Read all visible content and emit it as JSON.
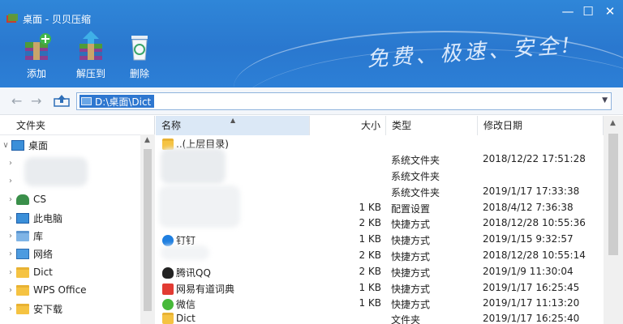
{
  "window": {
    "title": "桌面 - 贝贝压缩",
    "slogan": "免费、极速、安全!",
    "minimize": "—",
    "maximize": "☐",
    "close": "✕"
  },
  "toolbar": {
    "add_label": "添加",
    "extract_label": "解压到",
    "delete_label": "删除"
  },
  "address": {
    "path": "D:\\桌面\\Dict"
  },
  "left_panel": {
    "header": "文件夹",
    "items": [
      {
        "label": "桌面",
        "icon": "monitor-icon",
        "expanded": true
      },
      {
        "label": "",
        "icon": "blurred"
      },
      {
        "label": "",
        "icon": "blurred"
      },
      {
        "label": "CS",
        "icon": "user-icon"
      },
      {
        "label": "此电脑",
        "icon": "monitor-icon"
      },
      {
        "label": "库",
        "icon": "library-icon"
      },
      {
        "label": "网络",
        "icon": "network-icon"
      },
      {
        "label": "Dict",
        "icon": "folder-icon"
      },
      {
        "label": "WPS Office",
        "icon": "folder-icon"
      },
      {
        "label": "安下载",
        "icon": "folder-icon"
      }
    ]
  },
  "columns": {
    "name": "名称",
    "size": "大小",
    "type": "类型",
    "date": "修改日期"
  },
  "files": [
    {
      "name": "..(上层目录)",
      "size": "",
      "type": "",
      "date": "",
      "icon": "folder-icon"
    },
    {
      "name": "",
      "size": "",
      "type": "系统文件夹",
      "date": "2018/12/22 17:51:28",
      "icon": "blurred"
    },
    {
      "name": "",
      "size": "",
      "type": "系统文件夹",
      "date": "",
      "icon": "blurred"
    },
    {
      "name": "",
      "size": "",
      "type": "系统文件夹",
      "date": "2019/1/17 17:33:38",
      "icon": "blurred"
    },
    {
      "name": "",
      "size": "1 KB",
      "type": "配置设置",
      "date": "2018/4/12 7:36:38",
      "icon": "blurred"
    },
    {
      "name": "",
      "size": "2 KB",
      "type": "快捷方式",
      "date": "2018/12/28 10:55:36",
      "icon": "blurred"
    },
    {
      "name": "钉钉",
      "size": "1 KB",
      "type": "快捷方式",
      "date": "2019/1/15 9:32:57",
      "icon": "dingtalk-icon"
    },
    {
      "name": "",
      "size": "2 KB",
      "type": "快捷方式",
      "date": "2018/12/28 10:55:14",
      "icon": "blurred"
    },
    {
      "name": "腾讯QQ",
      "size": "2 KB",
      "type": "快捷方式",
      "date": "2019/1/9 11:30:04",
      "icon": "qq-icon"
    },
    {
      "name": "网易有道词典",
      "size": "1 KB",
      "type": "快捷方式",
      "date": "2019/1/17 16:25:45",
      "icon": "youdao-icon"
    },
    {
      "name": "微信",
      "size": "1 KB",
      "type": "快捷方式",
      "date": "2019/1/17 11:13:20",
      "icon": "wechat-icon"
    },
    {
      "name": "Dict",
      "size": "",
      "type": "文件夹",
      "date": "2019/1/17 16:25:40",
      "icon": "folder-icon"
    }
  ]
}
